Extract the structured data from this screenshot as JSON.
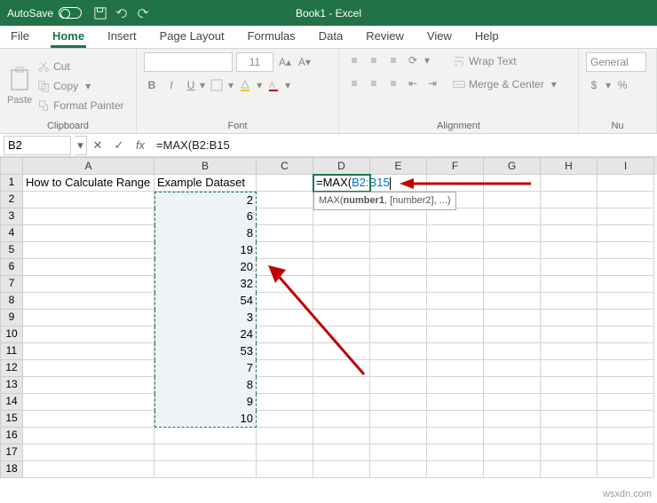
{
  "titlebar": {
    "autosave_label": "AutoSave",
    "title": "Book1 - Excel"
  },
  "tabs": {
    "file": "File",
    "home": "Home",
    "insert": "Insert",
    "page_layout": "Page Layout",
    "formulas": "Formulas",
    "data": "Data",
    "review": "Review",
    "view": "View",
    "help": "Help"
  },
  "ribbon": {
    "clipboard": {
      "paste": "Paste",
      "cut": "Cut",
      "copy": "Copy",
      "format_painter": "Format Painter",
      "label": "Clipboard"
    },
    "font": {
      "size": "11",
      "bold": "B",
      "italic": "I",
      "underline": "U",
      "label": "Font"
    },
    "alignment": {
      "wrap": "Wrap Text",
      "merge": "Merge & Center",
      "label": "Alignment"
    },
    "number": {
      "general": "General",
      "currency": "$",
      "percent": "%",
      "label": "Nu"
    }
  },
  "fx": {
    "namebox": "B2",
    "formula": "=MAX(B2:B15"
  },
  "columns": [
    "A",
    "B",
    "C",
    "D",
    "E",
    "F",
    "G",
    "H",
    "I"
  ],
  "sheet": {
    "a1": "How to Calculate Range",
    "b1": "Example Dataset",
    "d1_formula": "=MAX(",
    "d1_ref": "B2:B15",
    "tooltip": "MAX(number1, [number2], ...)",
    "bvals": [
      "2",
      "6",
      "8",
      "19",
      "20",
      "32",
      "54",
      "3",
      "24",
      "53",
      "7",
      "8",
      "9",
      "10"
    ]
  },
  "watermark": "wsxdn.com"
}
